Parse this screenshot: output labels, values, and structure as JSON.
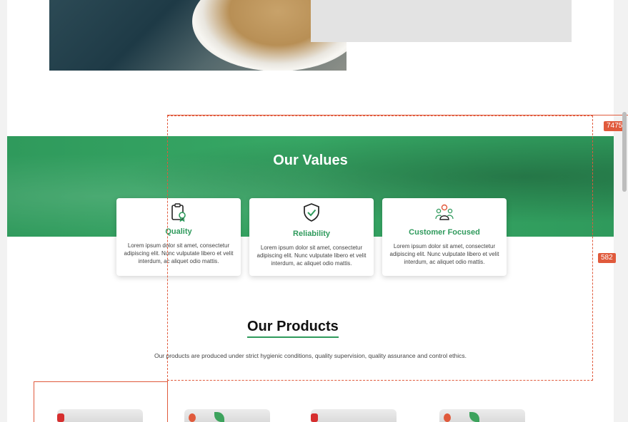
{
  "values": {
    "title": "Our Values",
    "cards": [
      {
        "icon": "clipboard-badge-icon",
        "title": "Quality",
        "desc": "Lorem ipsum dolor sit amet, consectetur adipiscing elit. Nunc vulputate libero et velit interdum, ac aliquet odio mattis."
      },
      {
        "icon": "shield-check-icon",
        "title": "Reliability",
        "desc": "Lorem ipsum dolor sit amet, consectetur adipiscing elit. Nunc vulputate libero et velit interdum, ac aliquet odio mattis."
      },
      {
        "icon": "people-group-icon",
        "title": "Customer Focused",
        "desc": "Lorem ipsum dolor sit amet, consectetur adipiscing elit. Nunc vulputate libero et velit interdum, ac aliquet odio mattis."
      }
    ]
  },
  "products": {
    "title": "Our Products",
    "subtitle": "Our products are produced under strict hygienic conditions, quality supervision, quality assurance and control ethics."
  },
  "overlay": {
    "badge_top": "7475",
    "badge_mid": "582"
  },
  "colors": {
    "brand_green": "#2f9a5c",
    "overlay_red": "#e05a3c"
  }
}
